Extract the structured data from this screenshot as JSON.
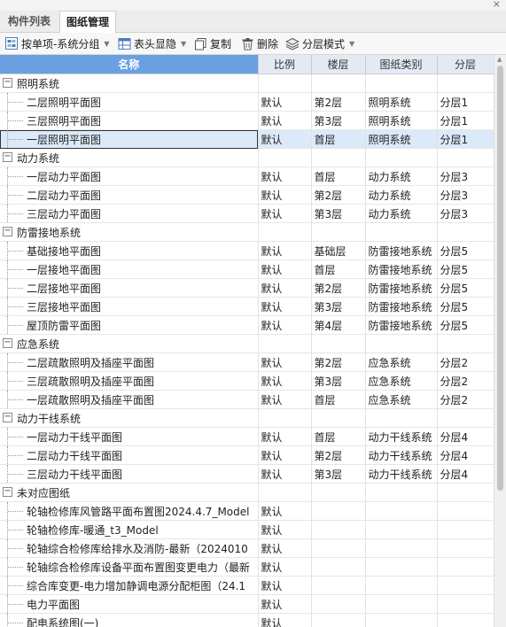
{
  "window": {
    "close_glyph": "×"
  },
  "tabs": [
    {
      "label": "构件列表"
    },
    {
      "label": "图纸管理"
    }
  ],
  "toolbar": {
    "group_by_label": "按单项-系统分组",
    "header_toggle_label": "表头显隐",
    "copy_label": "复制",
    "delete_label": "删除",
    "layer_mode_label": "分层模式",
    "dropdown_glyph": "▼"
  },
  "columns": [
    "名称",
    "比例",
    "楼层",
    "图纸类别",
    "分层"
  ],
  "rows": [
    {
      "type": "group",
      "name": "照明系统"
    },
    {
      "type": "item",
      "name": "二层照明平面图",
      "scale": "默认",
      "floor": "第2层",
      "category": "照明系统",
      "layer": "分层1"
    },
    {
      "type": "item",
      "name": "三层照明平面图",
      "scale": "默认",
      "floor": "第3层",
      "category": "照明系统",
      "layer": "分层1"
    },
    {
      "type": "item",
      "name": "一层照明平面图",
      "scale": "默认",
      "floor": "首层",
      "category": "照明系统",
      "layer": "分层1",
      "selected": true
    },
    {
      "type": "group",
      "name": "动力系统"
    },
    {
      "type": "item",
      "name": "一层动力平面图",
      "scale": "默认",
      "floor": "首层",
      "category": "动力系统",
      "layer": "分层3"
    },
    {
      "type": "item",
      "name": "二层动力平面图",
      "scale": "默认",
      "floor": "第2层",
      "category": "动力系统",
      "layer": "分层3"
    },
    {
      "type": "item",
      "name": "三层动力平面图",
      "scale": "默认",
      "floor": "第3层",
      "category": "动力系统",
      "layer": "分层3"
    },
    {
      "type": "group",
      "name": "防雷接地系统"
    },
    {
      "type": "item",
      "name": "基础接地平面图",
      "scale": "默认",
      "floor": "基础层",
      "category": "防雷接地系统",
      "layer": "分层5"
    },
    {
      "type": "item",
      "name": "一层接地平面图",
      "scale": "默认",
      "floor": "首层",
      "category": "防雷接地系统",
      "layer": "分层5"
    },
    {
      "type": "item",
      "name": "二层接地平面图",
      "scale": "默认",
      "floor": "第2层",
      "category": "防雷接地系统",
      "layer": "分层5"
    },
    {
      "type": "item",
      "name": "三层接地平面图",
      "scale": "默认",
      "floor": "第3层",
      "category": "防雷接地系统",
      "layer": "分层5"
    },
    {
      "type": "item",
      "name": "屋顶防雷平面图",
      "scale": "默认",
      "floor": "第4层",
      "category": "防雷接地系统",
      "layer": "分层5"
    },
    {
      "type": "group",
      "name": "应急系统"
    },
    {
      "type": "item",
      "name": "二层疏散照明及插座平面图",
      "scale": "默认",
      "floor": "第2层",
      "category": "应急系统",
      "layer": "分层2"
    },
    {
      "type": "item",
      "name": "三层疏散照明及插座平面图",
      "scale": "默认",
      "floor": "第3层",
      "category": "应急系统",
      "layer": "分层2"
    },
    {
      "type": "item",
      "name": "一层疏散照明及插座平面图",
      "scale": "默认",
      "floor": "首层",
      "category": "应急系统",
      "layer": "分层2"
    },
    {
      "type": "group",
      "name": "动力干线系统"
    },
    {
      "type": "item",
      "name": "一层动力干线平面图",
      "scale": "默认",
      "floor": "首层",
      "category": "动力干线系统",
      "layer": "分层4"
    },
    {
      "type": "item",
      "name": "二层动力干线平面图",
      "scale": "默认",
      "floor": "第2层",
      "category": "动力干线系统",
      "layer": "分层4"
    },
    {
      "type": "item",
      "name": "三层动力干线平面图",
      "scale": "默认",
      "floor": "第3层",
      "category": "动力干线系统",
      "layer": "分层4"
    },
    {
      "type": "group",
      "name": "未对应图纸"
    },
    {
      "type": "item",
      "name": "轮轴检修库风管路平面布置图2024.4.7_Model",
      "scale": "默认",
      "floor": "",
      "category": "",
      "layer": ""
    },
    {
      "type": "item",
      "name": "轮轴检修库-暖通_t3_Model",
      "scale": "默认",
      "floor": "",
      "category": "",
      "layer": ""
    },
    {
      "type": "item",
      "name": "轮轴综合检修库给排水及消防-最新（2024010",
      "scale": "默认",
      "floor": "",
      "category": "",
      "layer": ""
    },
    {
      "type": "item",
      "name": "轮轴综合检修库设备平面布置图变更电力（最新",
      "scale": "默认",
      "floor": "",
      "category": "",
      "layer": ""
    },
    {
      "type": "item",
      "name": "综合库变更-电力增加静调电源分配柜图（24.1",
      "scale": "默认",
      "floor": "",
      "category": "",
      "layer": ""
    },
    {
      "type": "item",
      "name": "电力平面图",
      "scale": "默认",
      "floor": "",
      "category": "",
      "layer": ""
    },
    {
      "type": "item",
      "name": "配电系统图(一)",
      "scale": "默认",
      "floor": "",
      "category": "",
      "layer": ""
    }
  ]
}
